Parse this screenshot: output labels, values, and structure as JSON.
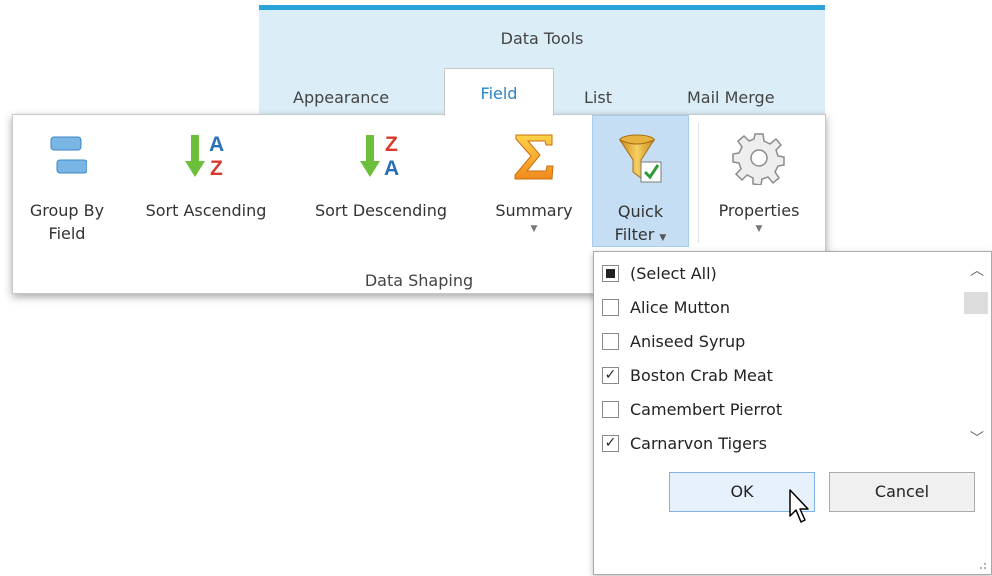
{
  "context_group": {
    "title": "Data Tools",
    "accent_color": "#2aa3db",
    "bg_color": "#dbeef8"
  },
  "tabs": [
    {
      "label": "Appearance",
      "active": false
    },
    {
      "label": "Field",
      "active": true
    },
    {
      "label": "List",
      "active": false
    },
    {
      "label": "Mail Merge",
      "active": false
    }
  ],
  "ribbon": {
    "group_label": "Data Shaping",
    "buttons": [
      {
        "line1": "Group By",
        "line2": "Field",
        "icon": "group-by-field-icon"
      },
      {
        "line1": "Sort Ascending",
        "icon": "sort-ascending-icon"
      },
      {
        "line1": "Sort Descending",
        "icon": "sort-descending-icon"
      },
      {
        "line1": "Summary",
        "icon": "sigma-icon",
        "has_dropdown": true
      },
      {
        "line1": "Quick",
        "line2": "Filter",
        "icon": "filter-funnel-icon",
        "has_dropdown": true,
        "pressed": true
      },
      {
        "line1": "Properties",
        "icon": "gear-icon",
        "has_dropdown": true
      }
    ]
  },
  "filter_popup": {
    "items": [
      {
        "label": "(Select All)",
        "state": "indeterminate"
      },
      {
        "label": "Alice Mutton",
        "state": "unchecked"
      },
      {
        "label": "Aniseed Syrup",
        "state": "unchecked"
      },
      {
        "label": "Boston Crab Meat",
        "state": "checked"
      },
      {
        "label": "Camembert Pierrot",
        "state": "unchecked"
      },
      {
        "label": "Carnarvon Tigers",
        "state": "checked"
      }
    ],
    "ok_label": "OK",
    "cancel_label": "Cancel"
  }
}
